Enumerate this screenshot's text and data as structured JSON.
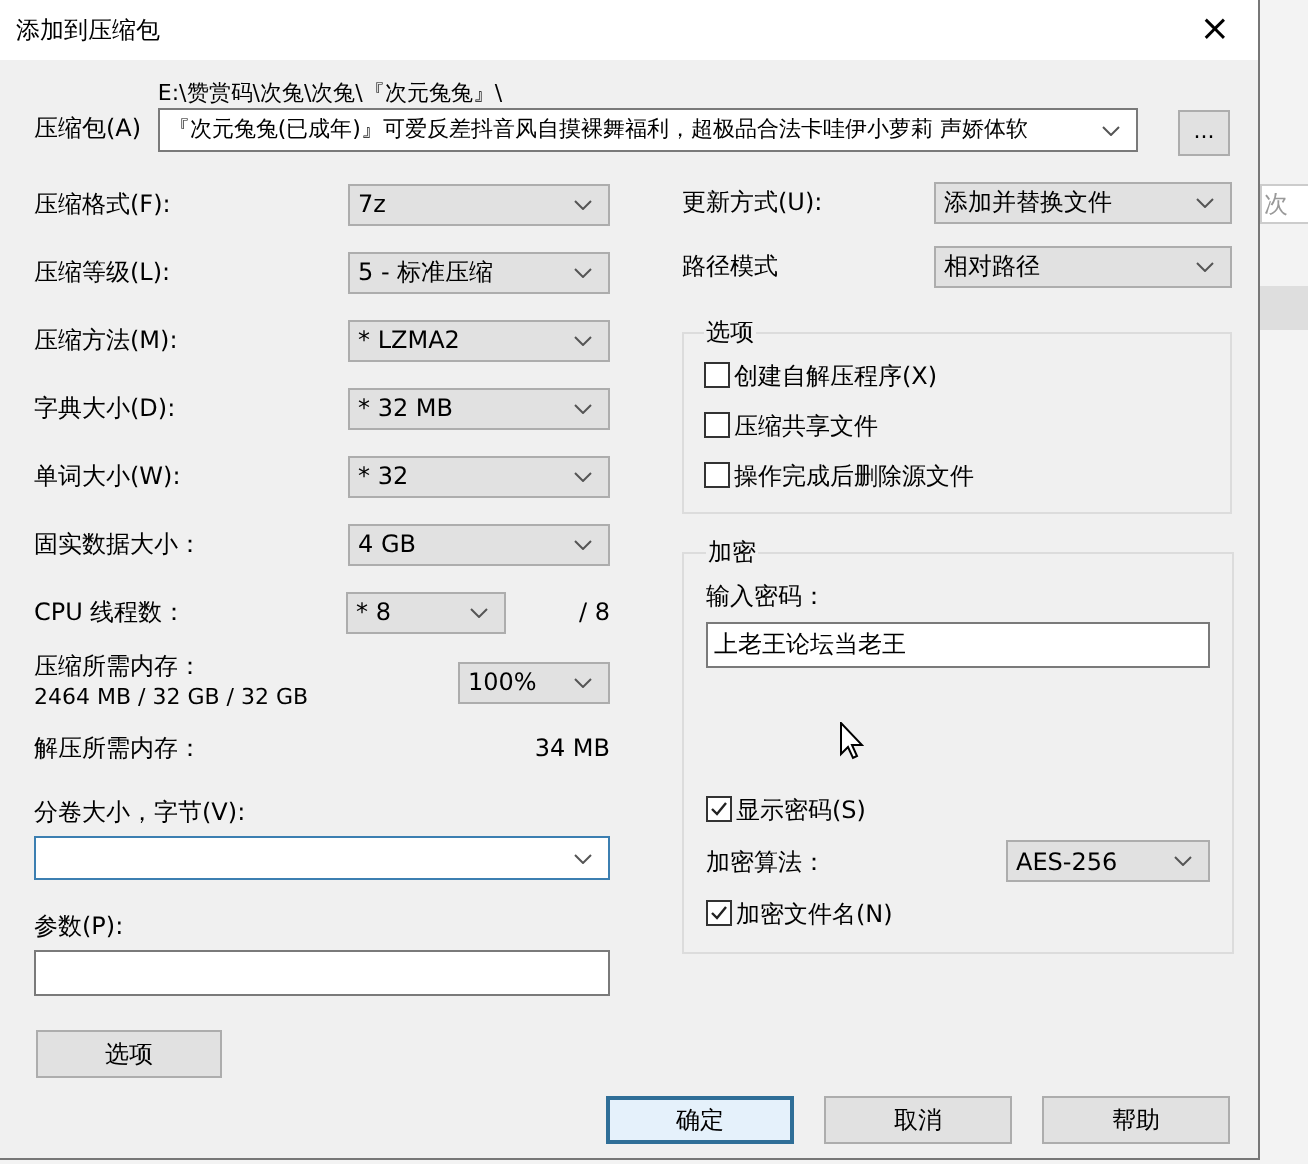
{
  "window": {
    "title": "添加到压缩包",
    "close": "×"
  },
  "archive": {
    "label": "压缩包(A)",
    "path": "E:\\赞赏码\\次兔\\次兔\\『次元兔兔』\\",
    "value": "『次元兔兔(已成年)』可爱反差抖音风自摸裸舞福利，超极品合法卡哇伊小萝莉 声娇体软",
    "browse": "..."
  },
  "combos": [
    {
      "label": "压缩格式(F):",
      "value": "7z"
    },
    {
      "label": "压缩等级(L):",
      "value": "5 - 标准压缩"
    },
    {
      "label": "压缩方法(M):",
      "value": "*  LZMA2"
    },
    {
      "label": "字典大小(D):",
      "value": "*  32 MB"
    },
    {
      "label": "单词大小(W):",
      "value": "*  32"
    },
    {
      "label": "固实数据大小：",
      "value": "4 GB"
    }
  ],
  "cpu": {
    "label": "CPU 线程数：",
    "value": "*  8",
    "max": "/ 8"
  },
  "memory": {
    "label": "压缩所需内存：",
    "detail": "2464 MB / 32 GB / 32 GB",
    "value": "100%"
  },
  "decompress_memory": {
    "label": "解压所需内存：",
    "value": "34 MB"
  },
  "volume": {
    "label": "分卷大小，字节(V):"
  },
  "parameters": {
    "label": "参数(P):"
  },
  "options_button": "选项",
  "update": {
    "label": "更新方式(U):",
    "value": "添加并替换文件"
  },
  "path_mode": {
    "label": "路径模式",
    "value": "相对路径"
  },
  "options": {
    "title": "选项",
    "items": [
      {
        "label": "创建自解压程序(X)",
        "checked": false
      },
      {
        "label": "压缩共享文件",
        "checked": false
      },
      {
        "label": "操作完成后删除源文件",
        "checked": false
      }
    ]
  },
  "encryption": {
    "title": "加密",
    "password_label": "输入密码：",
    "password": "上老王论坛当老王",
    "show_password": {
      "label": "显示密码(S)",
      "checked": true
    },
    "method_label": "加密算法：",
    "method": "AES-256",
    "encrypt_names": {
      "label": "加密文件名(N)",
      "checked": true
    }
  },
  "buttons": [
    {
      "label": "确定",
      "default": true
    },
    {
      "label": "取消",
      "default": false
    },
    {
      "label": "帮助",
      "default": false
    }
  ],
  "background_window": {
    "text": "次"
  }
}
